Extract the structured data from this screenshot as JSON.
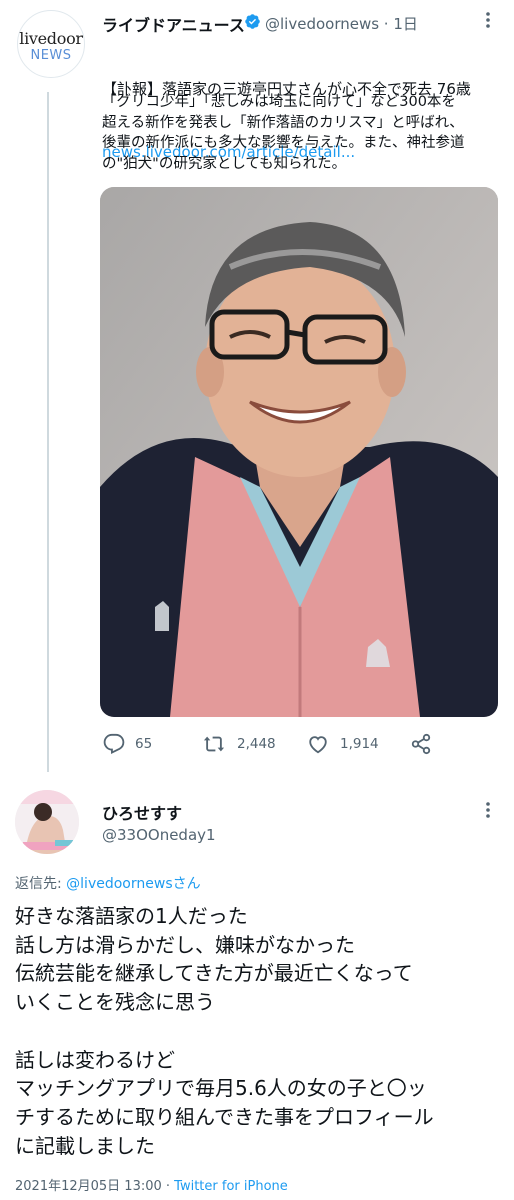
{
  "tweet1": {
    "avatar_line1": "livedoor",
    "avatar_line2": "NEWS",
    "display_name": "ライブドアニュース",
    "handle_time": "@livedoornews · 1日",
    "headline": "【訃報】落語家の三遊亭円丈さんが心不全で死去 76歳",
    "link": "news.livedoor.com/article/detail...",
    "body": "「グリコ少年」「悲しみは埼玉に向けて」など300本を\n超える新作を発表し「新作落語のカリスマ」と呼ばれ、\n後輩の新作派にも多大な影響を与えた。また、神社参道\nの\"狛犬\"の研究家としても知られた。",
    "replies": "65",
    "retweets": "2,448",
    "likes": "1,914"
  },
  "tweet2": {
    "display_name": "ひろせすす",
    "handle": "@33OOneday1",
    "reply_prefix": "返信先: ",
    "reply_handle": "@livedoornewsさん",
    "text": "好きな落語家の1人だった\n話し方は滑らかだし、嫌味がなかった\n伝統芸能を継承してきた方が最近亡くなって\nいくことを残念に思う\n\n話しは変わるけど\nマッチングアプリで毎月5.6人の女の子と〇ッ\nチするために取り組んできた事をプロフィール\nに記載しました",
    "footer_date": "2021年12月05日 13:00 · ",
    "footer_source": "Twitter for iPhone"
  },
  "colors": {
    "link": "#1d9bf0",
    "verified": "#1d9bf0",
    "muted": "#536471",
    "kimono": "#e39a9a"
  },
  "icons": [
    "verified-badge-icon",
    "more-icon",
    "reply-icon",
    "retweet-icon",
    "like-icon",
    "share-icon"
  ]
}
